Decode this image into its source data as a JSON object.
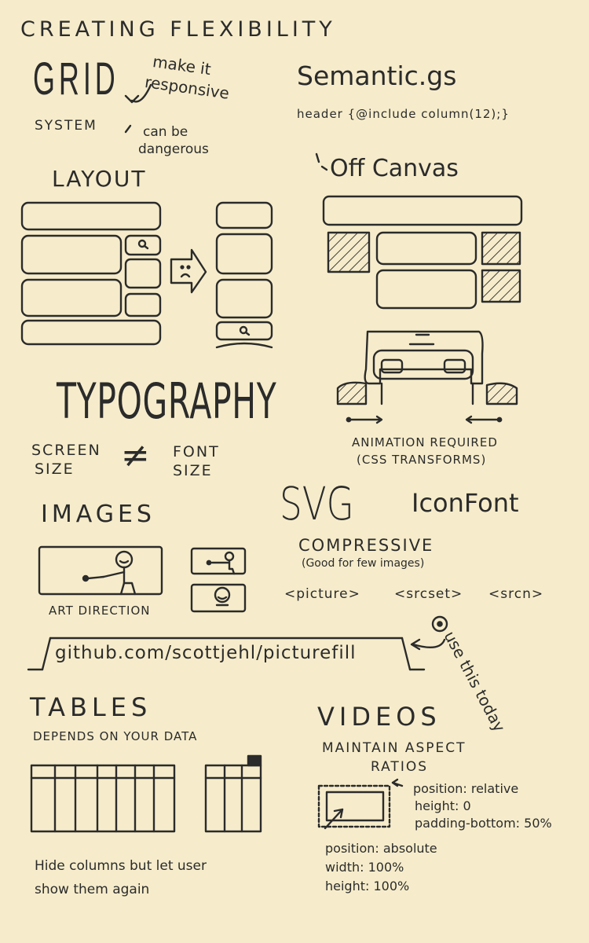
{
  "title": "CREATING FLEXIBILITY",
  "grid": {
    "heading": "GRID",
    "subheading": "SYSTEM",
    "note_responsive_1": "make it",
    "note_responsive_2": "responsive",
    "note_danger_1": "can be",
    "note_danger_2": "dangerous"
  },
  "semantic": {
    "heading": "Semantic.gs",
    "code": "header {@include column(12);}"
  },
  "layout": {
    "heading": "LAYOUT"
  },
  "offcanvas": {
    "heading": "Off Canvas",
    "animation_line1": "ANIMATION REQUIRED",
    "animation_line2": "(CSS TRANSFORMS)"
  },
  "typography": {
    "heading": "TYPOGRAPHY",
    "left_1": "SCREEN",
    "left_2": "SIZE",
    "symbol": "≠",
    "right_1": "FONT",
    "right_2": "SIZE"
  },
  "images": {
    "heading": "IMAGES",
    "caption": "ART DIRECTION",
    "svg": "SVG",
    "iconfont": "IconFont",
    "compressive": "COMPRESSIVE",
    "compressive_note": "(Good for few images)",
    "tags": [
      "<picture>",
      "<srcset>",
      "<srcn>"
    ],
    "link": "github.com/scottjehl/picturefill",
    "use_note": "use this today"
  },
  "tables": {
    "heading": "TABLES",
    "subheading": "DEPENDS ON YOUR DATA",
    "caption_1": "Hide columns but let user",
    "caption_2": "show them again"
  },
  "videos": {
    "heading": "VIDEOS",
    "sub_1": "MAINTAIN ASPECT",
    "sub_2": "RATIOS",
    "outer_1": "position: relative",
    "outer_2": "height: 0",
    "outer_3": "padding-bottom: 50%",
    "inner_1": "position: absolute",
    "inner_2": "width: 100%",
    "inner_3": "height: 100%"
  }
}
